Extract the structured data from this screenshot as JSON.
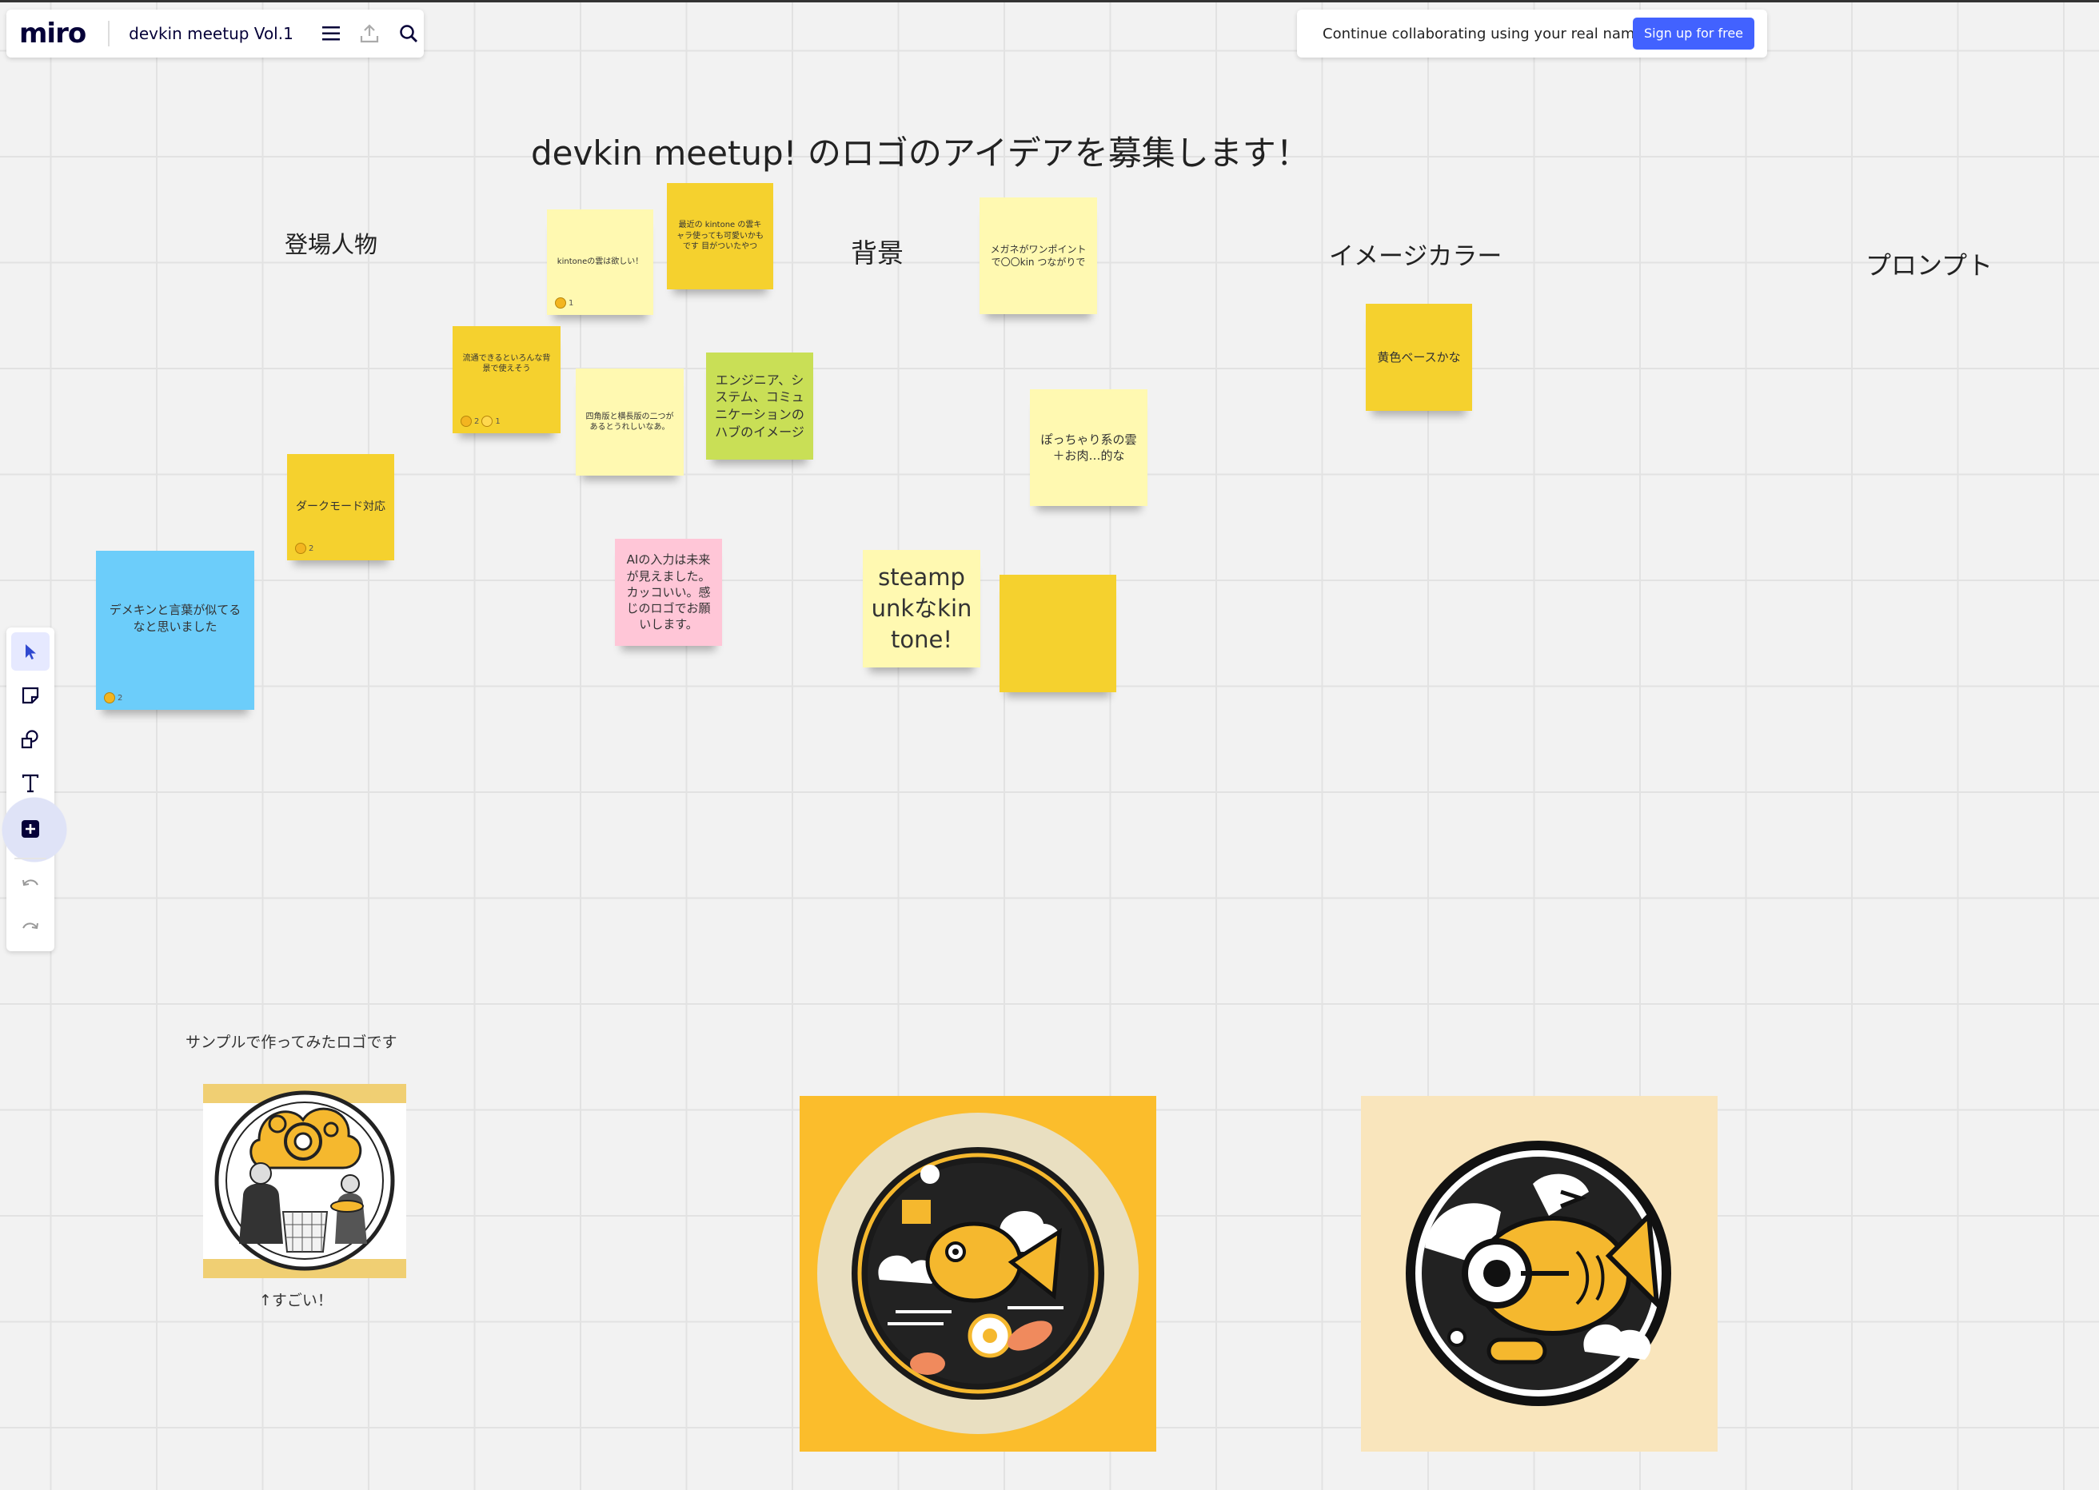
{
  "app": {
    "logo": "miro",
    "board_name": "devkin meetup Vol.1"
  },
  "signup_banner": {
    "text": "Continue collaborating using your real name.",
    "button": "Sign up for free"
  },
  "toolbar": {
    "tools": [
      "select",
      "sticky-note",
      "shapes",
      "text",
      "add",
      "undo",
      "redo"
    ]
  },
  "board": {
    "title": "devkin meetup! のロゴのアイデアを募集します！",
    "sections": {
      "characters": "登場人物",
      "background": "背景",
      "image_color": "イメージカラー",
      "prompt": "プロンプト"
    },
    "notes": {
      "kintone_cloud": {
        "text": "kintoneの雲は欲しい！",
        "react": "1"
      },
      "latest_character": {
        "text": "最近の kintone の雲キャラ使っても可愛いかもです 目がついたやつ"
      },
      "megane": {
        "text": "メガネがワンポイントで〇〇kin つながりで"
      },
      "various_scenes": {
        "text": "流通できるといろんな背景で使えそう",
        "react1": "2",
        "react2": "1"
      },
      "square_long": {
        "text": "四角版と横長版の二つがあるとうれしいなあ。"
      },
      "hub_image": {
        "text": "エンジニア、システム、コミュニケーションのハブのイメージ"
      },
      "chubby_cloud": {
        "text": "ぽっちゃり系の雲＋お肉…的な"
      },
      "yellow_base": {
        "text": "黄色ベースかな"
      },
      "dark_mode": {
        "text": "ダークモード対応",
        "react": "2"
      },
      "devkin_word": {
        "text": "デメキンと言葉が似てるなと思いました",
        "react": "2"
      },
      "ai_input": {
        "text": "AIの入力は未来が見えました。カッコいい。感じのロゴでお願いします。"
      },
      "steampunk": {
        "text": "steampunkなkintone!"
      },
      "empty": {
        "text": ""
      }
    },
    "sample_caption": "サンプルで作ってみたロゴです",
    "sample_comment": "↑すごい！"
  },
  "colors": {
    "accent": "#4262ff",
    "sticky_yellow": "#fff9b1",
    "sticky_gold": "#f5d12e",
    "sticky_green": "#c9df56",
    "sticky_pink": "#ffc6d7",
    "sticky_blue": "#6ccdfa"
  }
}
